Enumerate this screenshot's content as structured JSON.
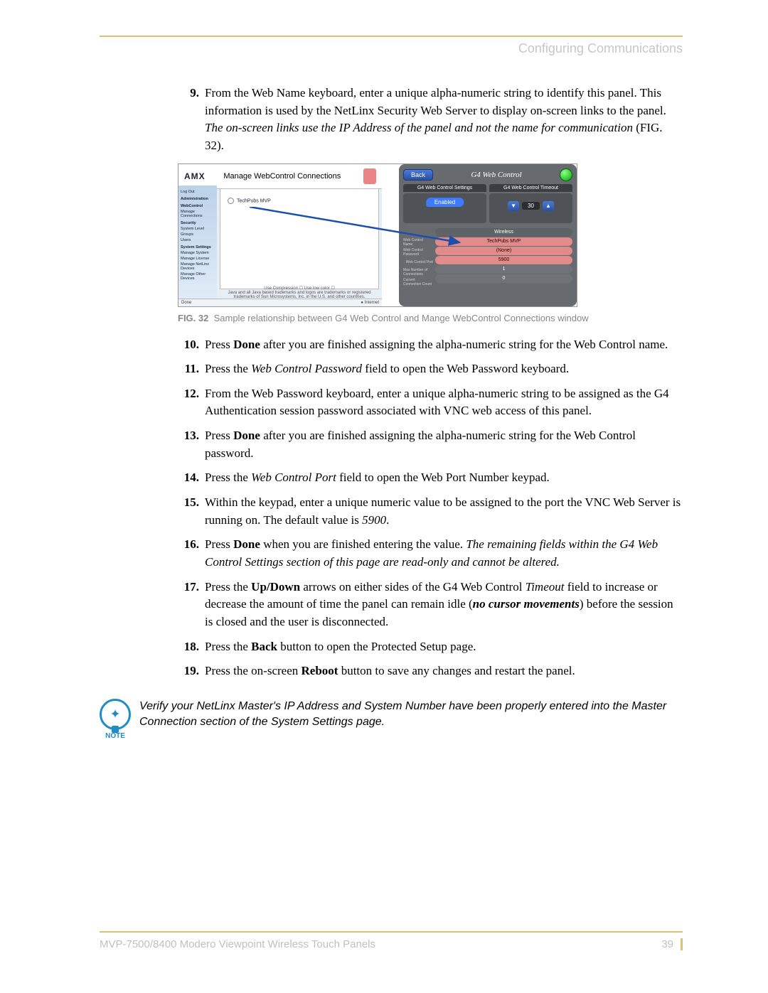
{
  "header": {
    "section": "Configuring Communications"
  },
  "steps": {
    "s9": {
      "n": "9.",
      "a": "From the Web Name keyboard, enter a unique alpha-numeric string to identify this panel. This information is used by the NetLinx Security Web Server to display on-screen links to the panel. ",
      "i": "The on-screen links use the IP Address of the panel and not the name for communication",
      "c": " (FIG. 32)."
    },
    "s10": {
      "n": "10.",
      "a": "Press ",
      "b": "Done",
      "c": " after you are finished assigning the alpha-numeric string for the Web Control name."
    },
    "s11": {
      "n": "11.",
      "a": "Press the ",
      "i": "Web Control Password",
      "c": " field to open the Web Password keyboard."
    },
    "s12": {
      "n": "12.",
      "a": "From the Web Password keyboard, enter a unique alpha-numeric string to be assigned as the G4 Authentication session password associated with VNC web access of this panel."
    },
    "s13": {
      "n": "13.",
      "a": "Press ",
      "b": "Done",
      "c": " after you are finished assigning the alpha-numeric string for the Web Control password."
    },
    "s14": {
      "n": "14.",
      "a": "Press the ",
      "i": "Web Control Port",
      "c": " field to open the Web Port Number keypad."
    },
    "s15": {
      "n": "15.",
      "a": "Within the keypad, enter a unique numeric value to be assigned to the port the VNC Web Server is running on. The default value is ",
      "i2": "5900",
      "c": "."
    },
    "s16": {
      "n": "16.",
      "a": "Press ",
      "b": "Done",
      "c": " when you are finished entering the value. ",
      "i": "The remaining fields within the G4 Web Control Settings section of this page are read-only and cannot be altered."
    },
    "s17": {
      "n": "17.",
      "a": "Press the ",
      "b": "Up/Down",
      "c": " arrows on either sides of the G4 Web Control ",
      "i": "Timeout",
      "d": " field to increase or decrease the amount of time the panel can remain idle (",
      "bi": "no cursor movements",
      "e": ") before the session is closed and the user is disconnected."
    },
    "s18": {
      "n": "18.",
      "a": "Press the ",
      "b": "Back",
      "c": " button to open the Protected Setup page."
    },
    "s19": {
      "n": "19.",
      "a": "Press the on-screen ",
      "b": "Reboot",
      "c": " button to save any changes and restart the panel."
    }
  },
  "figure": {
    "caption_label": "FIG. 32",
    "caption_text": "Sample relationship between G4 Web Control and Mange WebControl Connections window",
    "left": {
      "brand": "AMX",
      "title": "Manage WebControl Connections",
      "radio": "TechPubs MVP",
      "compress": "Use Compression ☐   Use low color ☐",
      "legal": "Java and all Java based trademarks and logos are trademarks or registered trademarks of Sun Microsystems, Inc. in the U.S. and other countries.",
      "status_left": "Done",
      "status_right": "● Internet",
      "menu": {
        "m0": "Log Out",
        "h0": "Administration",
        "h1": "WebControl",
        "m1": "Manage Connections",
        "h2": "Security",
        "m2": "System Level",
        "m3": "Groups",
        "m4": "Users",
        "h3": "System Settings",
        "m5": "Manage System",
        "m6": "Manage License",
        "m7": "Manage NetLinx Devices",
        "m8": "Manage Other Devices"
      }
    },
    "right": {
      "back": "Back",
      "title": "G4 Web Control",
      "tab1": "G4 Web Control Settings",
      "tab2": "G4 Web Control Timeout",
      "enabled": "Enabled",
      "stepper_val": "30",
      "labels": {
        "l1": "Web Control Name",
        "l2": "Web Control Password",
        "l3": "Web Control Port",
        "l4": "Max Number of Connections",
        "l5": "Current Connection Count"
      },
      "rows": {
        "r0": "Wireless",
        "r1": "TechPubs MVP",
        "r2": "(None)",
        "r3": "5900",
        "r4": "1",
        "r5": "0"
      }
    }
  },
  "note": {
    "label": "NOTE",
    "text": "Verify your NetLinx Master's IP Address and System Number have been properly entered into the Master Connection section of the System Settings page."
  },
  "footer": {
    "doc": "MVP-7500/8400 Modero Viewpoint Wireless Touch Panels",
    "page": "39"
  }
}
